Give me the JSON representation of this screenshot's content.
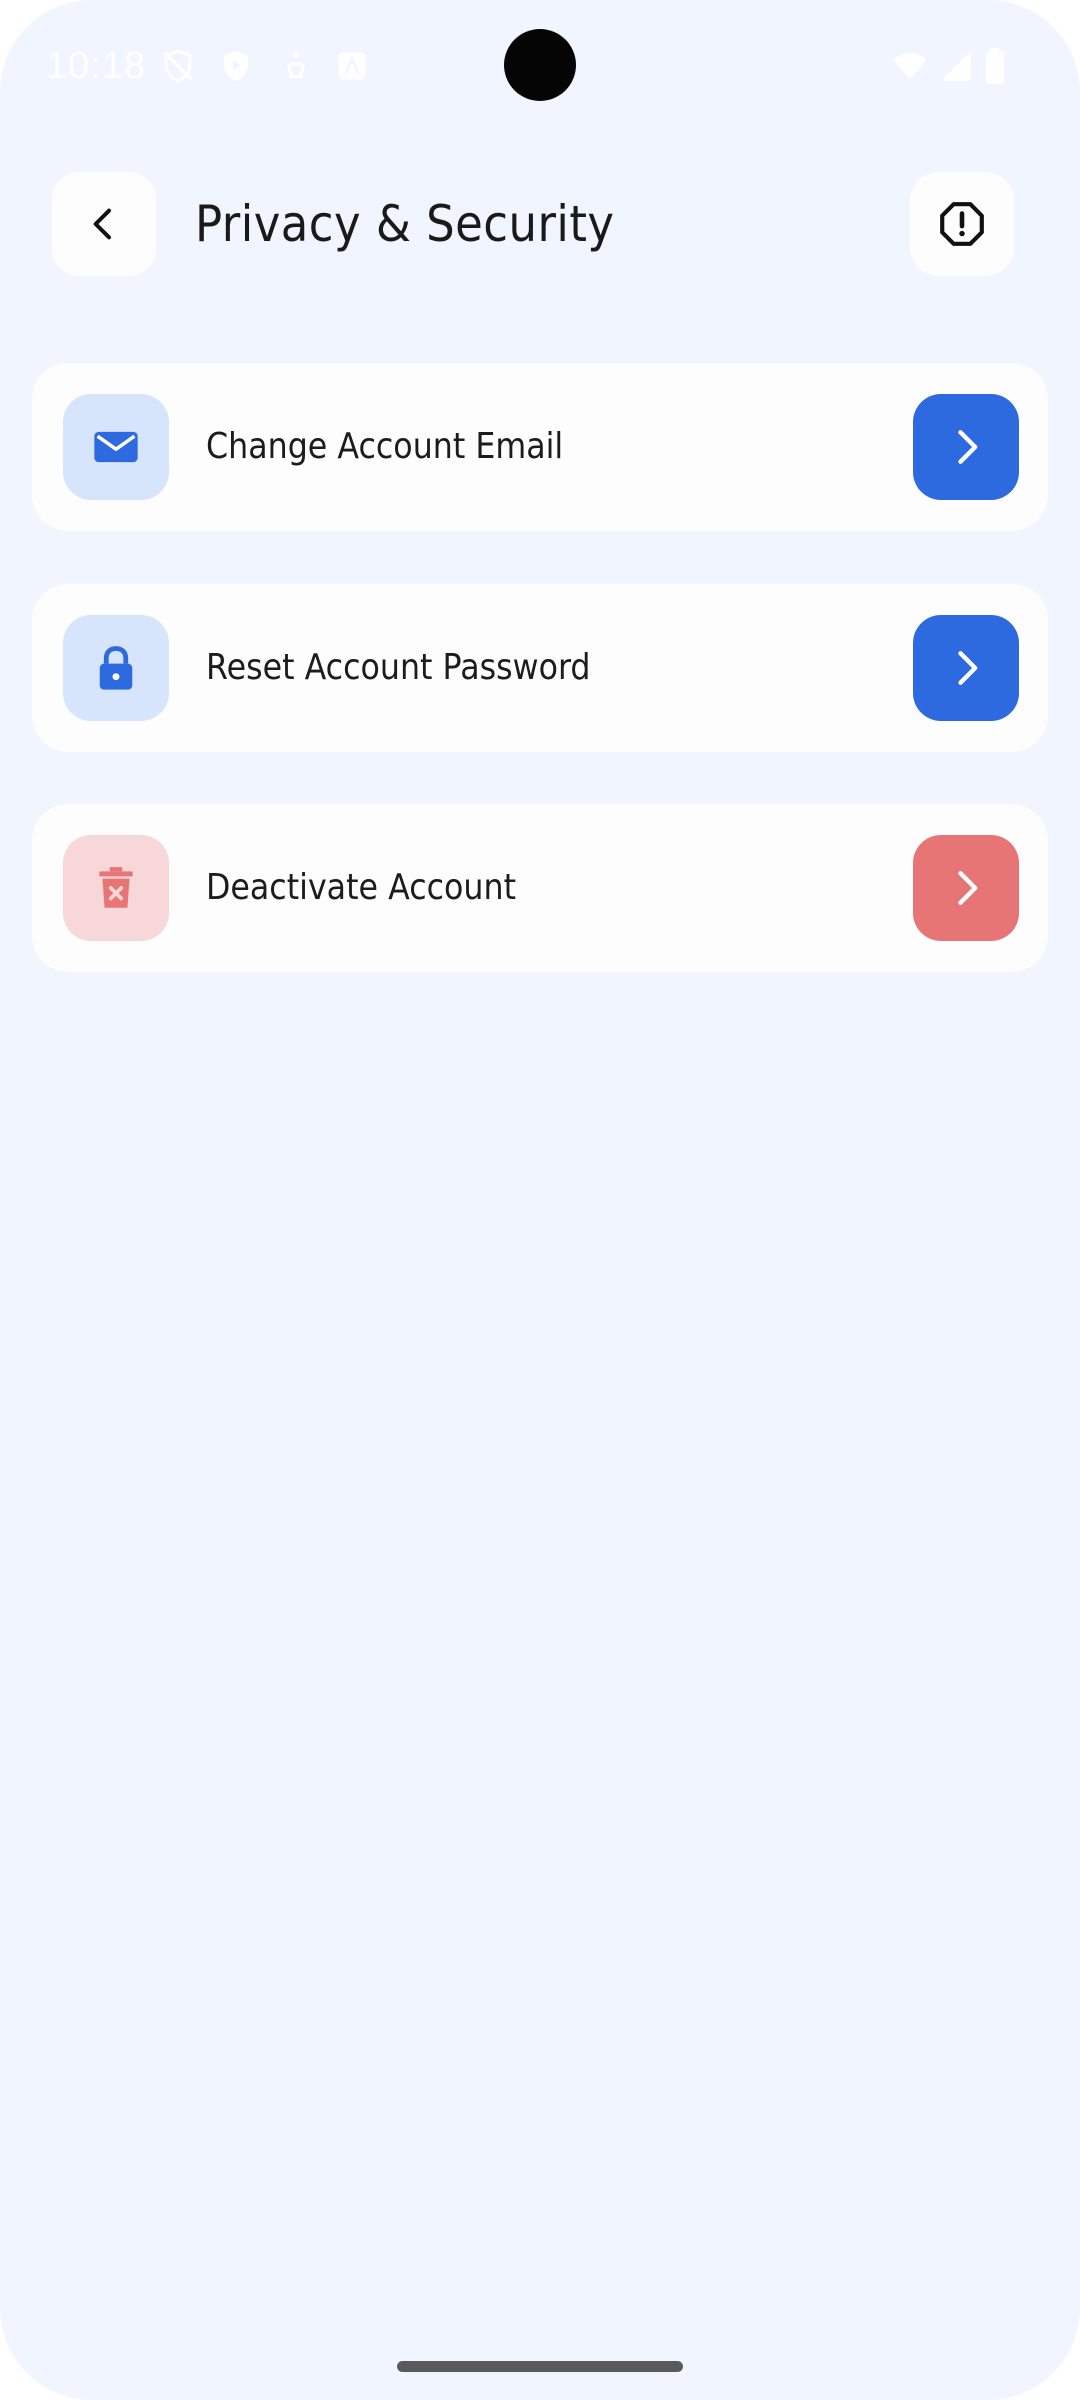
{
  "status_bar": {
    "time": "10:18"
  },
  "header": {
    "title": "Privacy & Security",
    "back_icon": "chevron-left-icon",
    "report_icon": "octagon-alert-icon"
  },
  "items": [
    {
      "label": "Change Account Email",
      "icon": "mail-icon",
      "accent": "#2d6ae0",
      "icon_bg": "#d6e4fc"
    },
    {
      "label": "Reset Account Password",
      "icon": "lock-icon",
      "accent": "#2d6ae0",
      "icon_bg": "#d6e4fc"
    },
    {
      "label": "Deactivate Account",
      "icon": "trash-icon",
      "accent": "#e87575",
      "icon_bg": "#f8d7d8"
    }
  ],
  "colors": {
    "background": "#f0f5ff",
    "card": "#fdfdfd",
    "primary": "#2d6ae0",
    "danger": "#e87575"
  }
}
